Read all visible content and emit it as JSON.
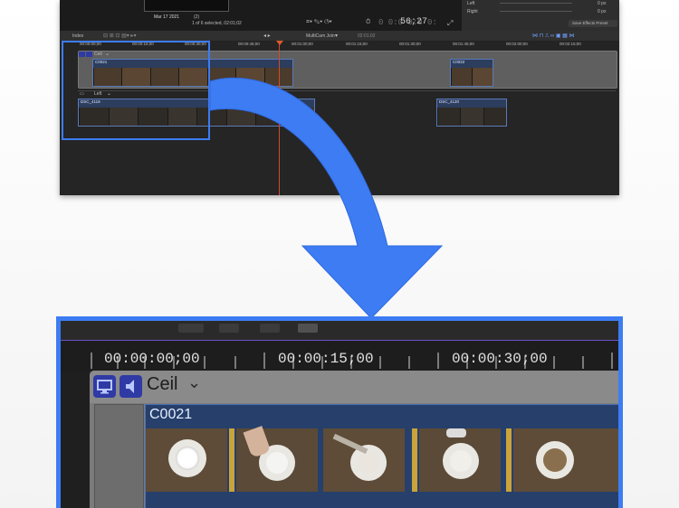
{
  "top_window": {
    "viewer_date": "Mar 17 2021",
    "viewer_date_suffix": "(2)",
    "selection_info": "1 of 6 selected, 02:01;02",
    "timecode": "56;27",
    "timecode_prefix": "0 0:0 0:0 0:",
    "inspector": {
      "rows": [
        {
          "label": "Left",
          "value": "0 px"
        },
        {
          "label": "Right",
          "value": "0 px"
        }
      ],
      "save_preset": "Save Effects Preset"
    },
    "index_button": "Index",
    "timeline_title": "MultiCam Join",
    "timeline_duration": "02:01;02",
    "ruler_marks": [
      "00:00:00;00",
      "00:00:15;00",
      "00:00:30;00",
      "00:00:45;00",
      "00:01:00;00",
      "00:01:15;00",
      "00:01:30;00",
      "00:01:45;00",
      "00:02:00;00",
      "00:02:15;00"
    ],
    "angles": [
      {
        "name": "Ceil",
        "clips": [
          {
            "label": "C0021"
          },
          {
            "label": "C0022"
          }
        ]
      },
      {
        "name": "Left",
        "clips": [
          {
            "label": "DSC_4119"
          },
          {
            "label": "DSC_4120"
          }
        ]
      }
    ]
  },
  "zoom": {
    "ruler_marks": [
      "00:00:00;00",
      "00:00:15;00",
      "00:00:30;00"
    ],
    "angle_name": "Ceil",
    "clip_label": "C0021"
  },
  "colors": {
    "selection_blue": "#3d7cf2",
    "clip_blue": "#26406b",
    "playhead": "#d14a2a"
  }
}
